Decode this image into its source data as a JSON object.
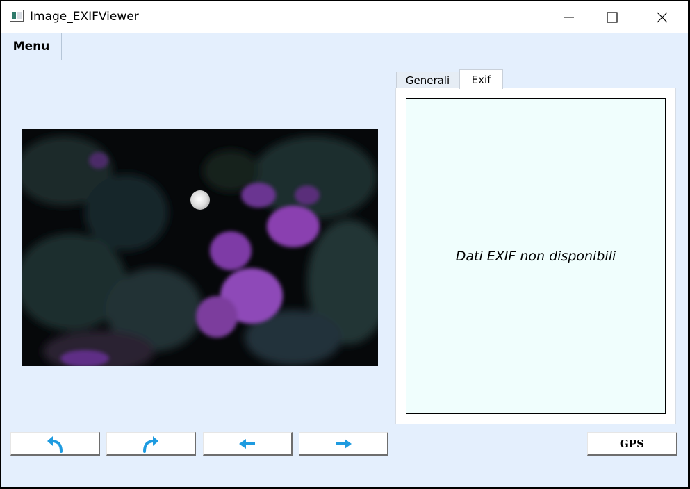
{
  "window": {
    "title": "Image_EXIFViewer",
    "icon": "app-image-icon",
    "controls": [
      "minimize-icon",
      "maximize-icon",
      "close-icon"
    ]
  },
  "menubar": {
    "menu_label": "Menu"
  },
  "image": {
    "description_icon": "photo-night-flowers-moon"
  },
  "tabs": [
    {
      "label": "Generali",
      "selected": false
    },
    {
      "label": "Exif",
      "selected": true
    }
  ],
  "exif_panel": {
    "message": "Dati EXIF non disponibili"
  },
  "toolbar": {
    "rotate_left_icon": "rotate-left-icon",
    "rotate_right_icon": "rotate-right-icon",
    "prev_icon": "arrow-left-icon",
    "next_icon": "arrow-right-icon",
    "gps_label": "GPS"
  },
  "colors": {
    "window_bg": "#e4effd",
    "exif_bg": "#f0fefd",
    "arrow_blue": "#1e9be0"
  }
}
